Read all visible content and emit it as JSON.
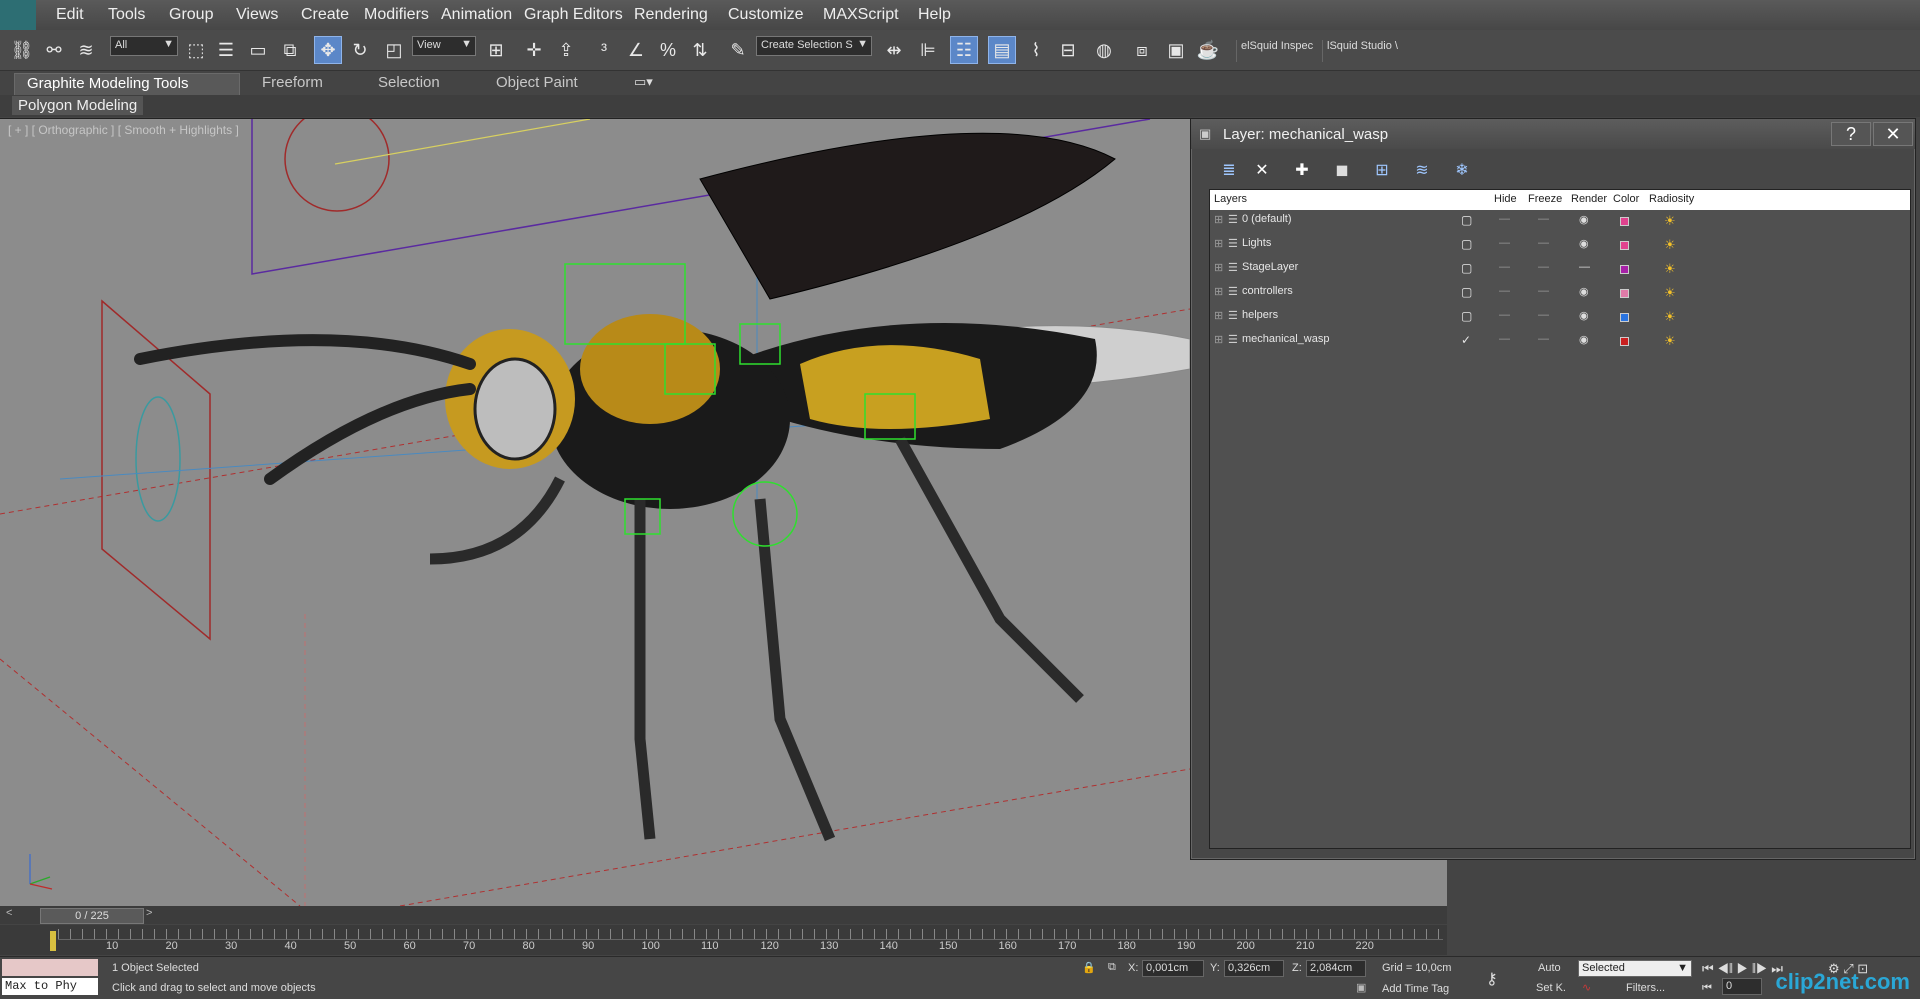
{
  "menubar": {
    "items": [
      "Edit",
      "Tools",
      "Group",
      "Views",
      "Create",
      "Modifiers",
      "Animation",
      "Graph Editors",
      "Rendering",
      "Customize",
      "MAXScript",
      "Help"
    ]
  },
  "toolbar": {
    "selection_filter": "All",
    "ref_coord": "View",
    "named_selection": "Create Selection S",
    "plugin1": "elSquid Inspec",
    "plugin2": "lSquid Studio \\"
  },
  "ribbon": {
    "tabs": [
      "Graphite Modeling Tools",
      "Freeform",
      "Selection",
      "Object Paint"
    ],
    "sub_tab": "Polygon Modeling"
  },
  "viewport": {
    "label": "[ + ] [ Orthographic ] [ Smooth + Highlights ]"
  },
  "layer_panel": {
    "title": "Layer: mechanical_wasp",
    "help": "?",
    "close": "✕",
    "columns": [
      "Layers",
      "Hide",
      "Freeze",
      "Render",
      "Color",
      "Radiosity"
    ],
    "rows": [
      {
        "name": "0 (default)",
        "color": "#e0428e",
        "current": false
      },
      {
        "name": "Lights",
        "color": "#e0428e",
        "current": false
      },
      {
        "name": "StageLayer",
        "color": "#a822a8",
        "current": false
      },
      {
        "name": "controllers",
        "color": "#e07aa8",
        "current": false
      },
      {
        "name": "helpers",
        "color": "#2a74e0",
        "current": false
      },
      {
        "name": "mechanical_wasp",
        "color": "#c82020",
        "current": true
      }
    ]
  },
  "timeline": {
    "slider": "0 / 225",
    "ticks": [
      "10",
      "20",
      "30",
      "40",
      "50",
      "60",
      "70",
      "80",
      "90",
      "100",
      "110",
      "120",
      "130",
      "140",
      "150",
      "160",
      "170",
      "180",
      "190",
      "200",
      "210",
      "220"
    ]
  },
  "status": {
    "listener": "Max to Phy",
    "selected": "1 Object Selected",
    "prompt": "Click and drag to select and move objects",
    "x": "0,001cm",
    "y": "0,326cm",
    "z": "2,084cm",
    "grid": "Grid = 10,0cm",
    "add_time_tag": "Add Time Tag",
    "auto": "Auto",
    "set_key": "Set K.",
    "key_mode": "Selected",
    "filters": "Filters...",
    "frame": "0"
  },
  "watermark": "clip2net.com"
}
